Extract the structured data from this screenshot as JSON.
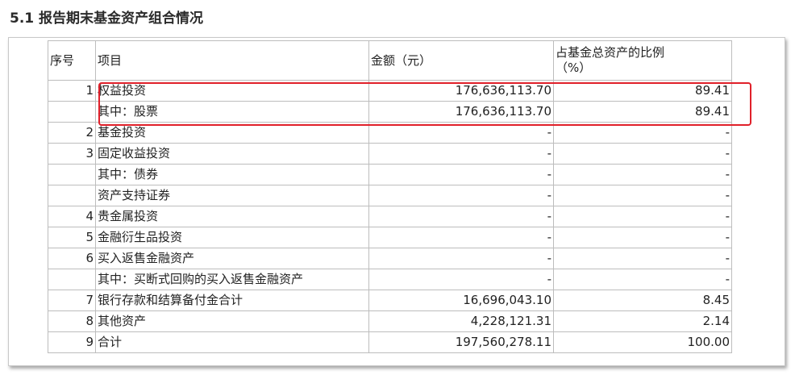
{
  "section_title": "5.1 报告期末基金资产组合情况",
  "headers": {
    "no": "序号",
    "item": "项目",
    "amount": "金额（元）",
    "pct_line1": "占基金总资产的比例",
    "pct_line2": "（%）"
  },
  "rows": [
    {
      "no": "1",
      "item": "权益投资",
      "amount": "176,636,113.70",
      "pct": "89.41",
      "indent": false
    },
    {
      "no": "",
      "item": "其中：股票",
      "amount": "176,636,113.70",
      "pct": "89.41",
      "indent": false
    },
    {
      "no": "2",
      "item": "基金投资",
      "amount": "-",
      "pct": "-",
      "indent": false
    },
    {
      "no": "3",
      "item": "固定收益投资",
      "amount": "-",
      "pct": "-",
      "indent": false
    },
    {
      "no": "",
      "item": "其中：债券",
      "amount": "-",
      "pct": "-",
      "indent": true
    },
    {
      "no": "",
      "item": "资产支持证券",
      "amount": "-",
      "pct": "-",
      "indent": true
    },
    {
      "no": "4",
      "item": "贵金属投资",
      "amount": "-",
      "pct": "-",
      "indent": false
    },
    {
      "no": "5",
      "item": "金融衍生品投资",
      "amount": "-",
      "pct": "-",
      "indent": false
    },
    {
      "no": "6",
      "item": "买入返售金融资产",
      "amount": "-",
      "pct": "-",
      "indent": false
    },
    {
      "no": "",
      "item": "其中：买断式回购的买入返售金融资产",
      "amount": "-",
      "pct": "-",
      "indent": true
    },
    {
      "no": "7",
      "item": "银行存款和结算备付金合计",
      "amount": "16,696,043.10",
      "pct": "8.45",
      "indent": false
    },
    {
      "no": "8",
      "item": "其他资产",
      "amount": "4,228,121.31",
      "pct": "2.14",
      "indent": false
    },
    {
      "no": "9",
      "item": "合计",
      "amount": "197,560,278.11",
      "pct": "100.00",
      "indent": false
    }
  ],
  "annotation_color": "#e0202a"
}
